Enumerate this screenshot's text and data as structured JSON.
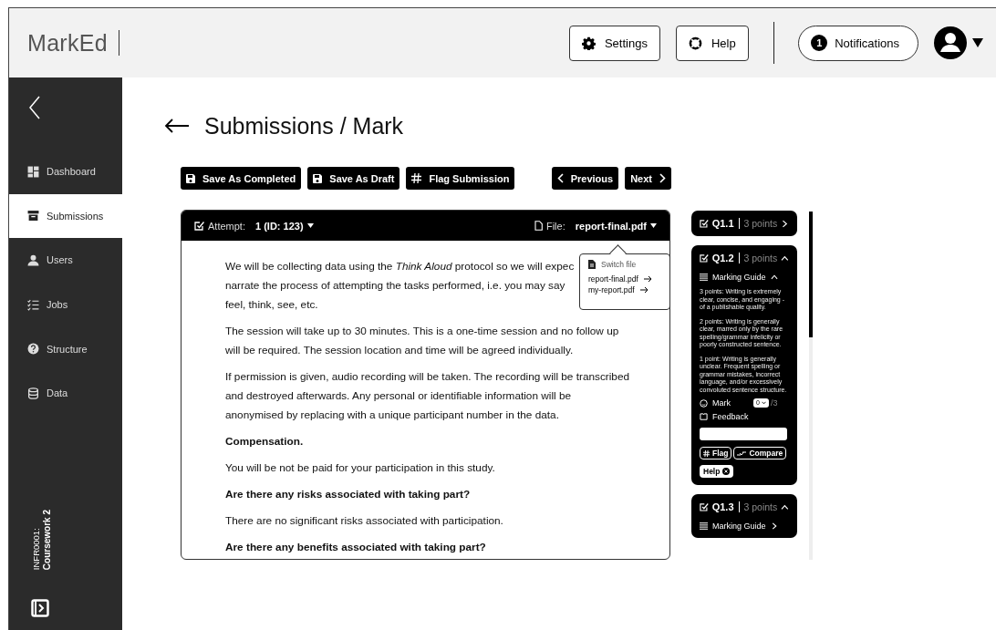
{
  "app": {
    "logo": "MarkEd"
  },
  "header": {
    "buttons": [
      {
        "label": "Settings",
        "kind": "settings"
      },
      {
        "label": "Help",
        "kind": "help"
      }
    ],
    "notifications": {
      "count": "1",
      "label": "Notifications"
    }
  },
  "sidebar": {
    "items": [
      {
        "label": "Dashboard",
        "kind": "dashboard",
        "selected": false
      },
      {
        "label": "Submissions",
        "kind": "submissions",
        "selected": true
      },
      {
        "label": "Users",
        "kind": "users",
        "selected": false
      },
      {
        "label": "Jobs",
        "kind": "jobs",
        "selected": false
      },
      {
        "label": "Structure",
        "kind": "structure",
        "selected": false
      },
      {
        "label": "Data",
        "kind": "data",
        "selected": false
      }
    ],
    "course": {
      "code": "INFR0001:",
      "name": "Coursework 2"
    }
  },
  "page": {
    "title": "Submissions / Mark"
  },
  "toolbar": {
    "actions": [
      {
        "label": "Save As Completed",
        "kind": "save"
      },
      {
        "label": "Save As Draft",
        "kind": "save"
      },
      {
        "label": "Flag Submission",
        "kind": "flag"
      }
    ],
    "nav": [
      {
        "label": "Previous",
        "kind": "prev"
      },
      {
        "label": "Next",
        "kind": "next"
      }
    ]
  },
  "document": {
    "attempt_label": "Attempt:",
    "attempt_value": "1 (ID: 123)",
    "file_label": "File:",
    "file_value": "report-final.pdf",
    "blocks": [
      {
        "kind": "text",
        "lines": [
          "We will be collecting data using the *Think Aloud* protocol so we will expec",
          "narrate the process of attempting the tasks performed, i.e. you may say",
          "feel, think, see, etc."
        ]
      },
      {
        "kind": "text",
        "lines": [
          "The session will take up to 30 minutes. This is a one-time session and no follow up",
          "will be required. The session location and time will be agreed individually."
        ]
      },
      {
        "kind": "text",
        "lines": [
          "If permission is given, audio recording will be taken. The recording will be transcribed",
          "and destroyed afterwards. Any personal or identifiable information will be",
          "anonymised by replacing with a unique participant number in the data."
        ]
      },
      {
        "kind": "heading",
        "lines": [
          "Compensation."
        ]
      },
      {
        "kind": "text",
        "lines": [
          "You will be not be paid for your participation in this study."
        ]
      },
      {
        "kind": "heading",
        "lines": [
          "Are there any risks associated with taking part?"
        ]
      },
      {
        "kind": "text",
        "lines": [
          "There are no significant risks associated with participation."
        ]
      },
      {
        "kind": "heading",
        "lines": [
          "Are there any benefits associated with taking part?"
        ]
      }
    ],
    "file_menu": {
      "title": "Switch file",
      "files": [
        "report-final.pdf",
        "my-report.pdf"
      ]
    }
  },
  "questions": [
    {
      "id": "Q1.1",
      "points": "3 points",
      "expanded": false
    },
    {
      "id": "Q1.2",
      "points": "3 points",
      "expanded": true,
      "guide": {
        "label": "Marking Guide",
        "expanded": true,
        "paragraphs": [
          "3 points: Writing is extremely clear, concise, and engaging - of a publishable quality.",
          "2 points: Writing is generally clear, marred only by the rare spelling/grammar infelicity or poorly constructed sentence.",
          "1 point: Writing is generally unclear. Frequent spelling or grammar mistakes, incorrect language, and/or excessively convoluted sentence structure."
        ]
      },
      "mark": {
        "label": "Mark",
        "value": "0",
        "max": "/3"
      },
      "feedback": {
        "label": "Feedback"
      },
      "buttons": [
        {
          "label": "Flag",
          "kind": "flag"
        },
        {
          "label": "Compare",
          "kind": "compare"
        }
      ],
      "help": "Help"
    },
    {
      "id": "Q1.3",
      "points": "3 points",
      "expanded": true,
      "guide": {
        "label": "Marking Guide",
        "expanded": false
      }
    }
  ]
}
